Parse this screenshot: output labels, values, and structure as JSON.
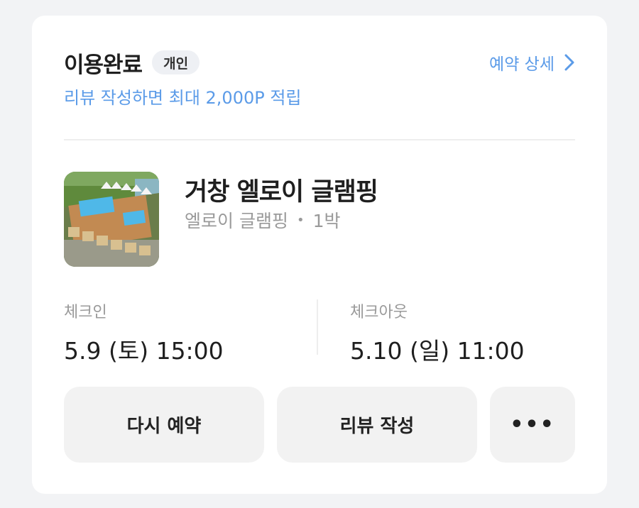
{
  "header": {
    "status": "이용완료",
    "badge": "개인",
    "detail_link": "예약 상세",
    "promo": "리뷰 작성하면 최대 2,000P 적립"
  },
  "stay": {
    "name": "거창 엘로이 글램핑",
    "property": "엘로이 글램핑",
    "nights": "1박",
    "thumbnail_icon": "glamping-photo"
  },
  "checkin": {
    "label": "체크인",
    "value": "5.9 (토) 15:00"
  },
  "checkout": {
    "label": "체크아웃",
    "value": "5.10 (일) 11:00"
  },
  "actions": {
    "rebook": "다시 예약",
    "review": "리뷰 작성",
    "more": "•••"
  },
  "colors": {
    "accent": "#5b9be8",
    "text": "#1f1f1f",
    "muted": "#9a9a9a",
    "button_bg": "#f2f2f2"
  }
}
